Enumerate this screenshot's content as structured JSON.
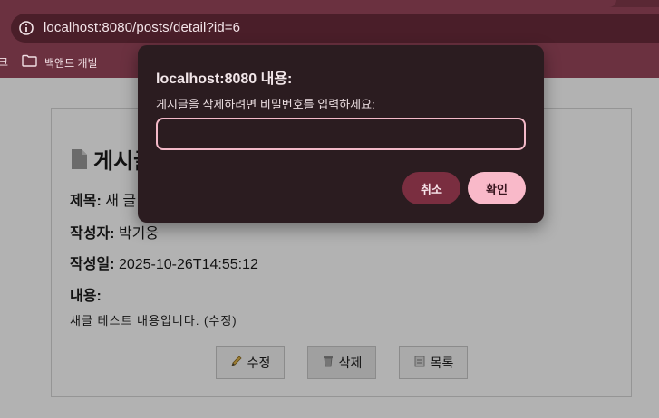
{
  "browser": {
    "url": "localhost:8080/posts/detail?id=6",
    "bookmarks": [
      {
        "label": "크"
      },
      {
        "label": "백앤드 개빌"
      }
    ]
  },
  "post": {
    "heading": "게시글",
    "fields": [
      {
        "label": "제목:",
        "value": "새 글 테스트"
      },
      {
        "label": "작성자:",
        "value": "박기웅"
      },
      {
        "label": "작성일:",
        "value": "2025-10-26T14:55:12"
      },
      {
        "label": "내용:",
        "value": ""
      }
    ],
    "content": "새글 테스트 내용입니다. (수정)",
    "buttons": {
      "edit": "수정",
      "delete": "삭제",
      "list": "목록"
    }
  },
  "dialog": {
    "title": "localhost:8080 내용:",
    "message": "게시글을 삭제하려면 비밀번호를 입력하세요:",
    "input_value": "",
    "cancel_label": "취소",
    "ok_label": "확인"
  },
  "colors": {
    "chrome": "#6b3140",
    "dialog_bg": "#2b1c20",
    "input_border": "#f4b9c8",
    "cancel_button": "#7a2e40",
    "ok_button": "#f9b9c9"
  },
  "icons": {
    "omnibox": "info-icon",
    "bookmark": "folder-icon",
    "heading": "document-icon",
    "edit": "pencil-icon",
    "delete": "trash-icon",
    "list": "clipboard-icon"
  }
}
